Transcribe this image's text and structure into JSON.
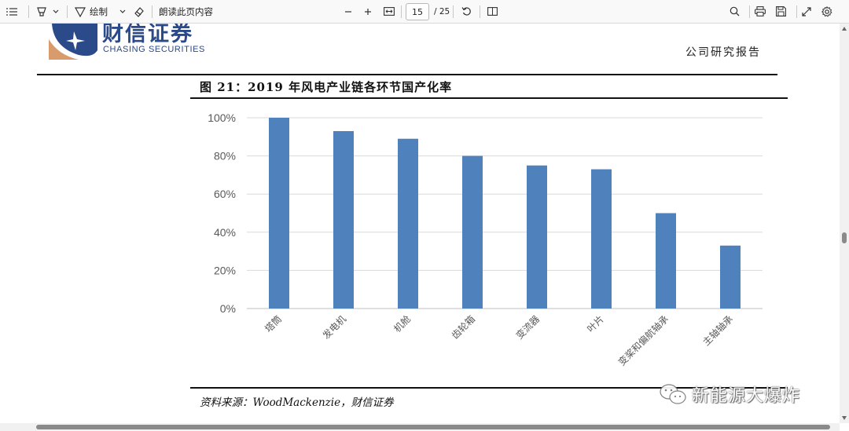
{
  "toolbar": {
    "draw_label": "绘制",
    "read_aloud_label": "朗读此页内容",
    "page_current": "15",
    "page_total": "/ 25"
  },
  "header": {
    "logo_cn": "财信证券",
    "logo_en": "CHASING SECURITIES",
    "report_type": "公司研究报告"
  },
  "figure": {
    "title": "图 21：2019 年风电产业链各环节国产化率",
    "source": "资料来源：WoodMackenzie，财信证券"
  },
  "watermark": {
    "text": "新能源大爆炸"
  },
  "colors": {
    "bar": "#4f81bd",
    "grid": "#d9d9d9",
    "axis_text": "#595959",
    "logo_blue": "#2a4a8a",
    "logo_orange": "#d99a6c"
  },
  "chart_data": {
    "type": "bar",
    "categories": [
      "塔筒",
      "发电机",
      "机舱",
      "齿轮箱",
      "变流器",
      "叶片",
      "变桨和偏航轴承",
      "主轴轴承"
    ],
    "values": [
      100,
      93,
      89,
      80,
      75,
      73,
      50,
      33
    ],
    "yticks": [
      "0%",
      "20%",
      "40%",
      "60%",
      "80%",
      "100%"
    ],
    "ylim": [
      0,
      100
    ],
    "grid": true,
    "legend": "none",
    "title": "图 21：2019 年风电产业链各环节国产化率"
  }
}
